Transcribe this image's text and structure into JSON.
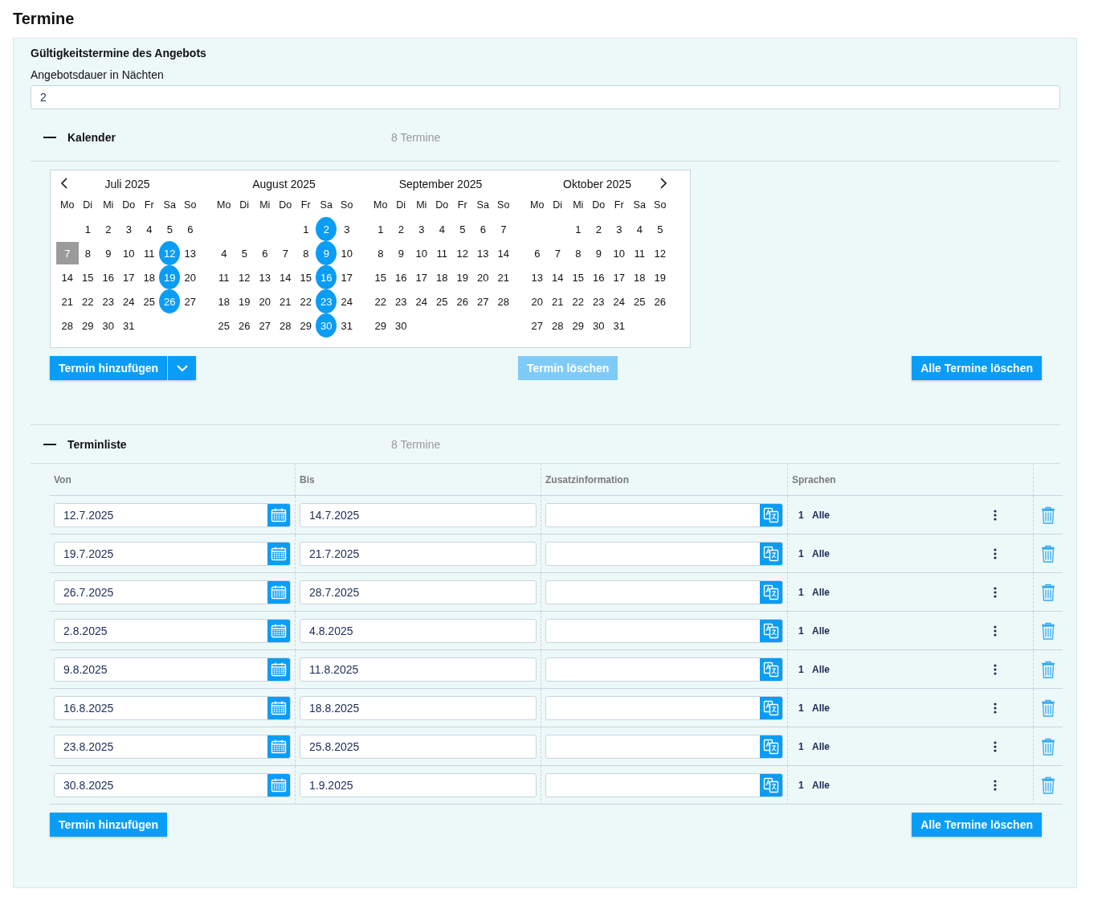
{
  "title": "Termine",
  "panel": {
    "heading": "Gültigkeitstermine des Angebots",
    "duration": {
      "label": "Angebotsdauer in Nächten",
      "value": "2"
    }
  },
  "calendar_section": {
    "title": "Kalender",
    "count": "8 Termine",
    "expanded": true,
    "months": [
      {
        "title": "Juli 2025",
        "weekdays": [
          "Mo",
          "Di",
          "Mi",
          "Do",
          "Fr",
          "Sa",
          "So"
        ],
        "weeks": [
          [
            {
              "kind": "blank"
            },
            {
              "kind": "day",
              "d": "1",
              "selected": false,
              "today": false
            },
            {
              "kind": "day",
              "d": "2",
              "selected": false,
              "today": false
            },
            {
              "kind": "day",
              "d": "3",
              "selected": false,
              "today": false
            },
            {
              "kind": "day",
              "d": "4",
              "selected": false,
              "today": false
            },
            {
              "kind": "day",
              "d": "5",
              "selected": false,
              "today": false
            },
            {
              "kind": "day",
              "d": "6",
              "selected": false,
              "today": false
            }
          ],
          [
            {
              "kind": "day",
              "d": "7",
              "selected": false,
              "today": true
            },
            {
              "kind": "day",
              "d": "8",
              "selected": false,
              "today": false
            },
            {
              "kind": "day",
              "d": "9",
              "selected": false,
              "today": false
            },
            {
              "kind": "day",
              "d": "10",
              "selected": false,
              "today": false
            },
            {
              "kind": "day",
              "d": "11",
              "selected": false,
              "today": false
            },
            {
              "kind": "day",
              "d": "12",
              "selected": true,
              "today": false
            },
            {
              "kind": "day",
              "d": "13",
              "selected": false,
              "today": false
            }
          ],
          [
            {
              "kind": "day",
              "d": "14",
              "selected": false,
              "today": false
            },
            {
              "kind": "day",
              "d": "15",
              "selected": false,
              "today": false
            },
            {
              "kind": "day",
              "d": "16",
              "selected": false,
              "today": false
            },
            {
              "kind": "day",
              "d": "17",
              "selected": false,
              "today": false
            },
            {
              "kind": "day",
              "d": "18",
              "selected": false,
              "today": false
            },
            {
              "kind": "day",
              "d": "19",
              "selected": true,
              "today": false
            },
            {
              "kind": "day",
              "d": "20",
              "selected": false,
              "today": false
            }
          ],
          [
            {
              "kind": "day",
              "d": "21",
              "selected": false,
              "today": false
            },
            {
              "kind": "day",
              "d": "22",
              "selected": false,
              "today": false
            },
            {
              "kind": "day",
              "d": "23",
              "selected": false,
              "today": false
            },
            {
              "kind": "day",
              "d": "24",
              "selected": false,
              "today": false
            },
            {
              "kind": "day",
              "d": "25",
              "selected": false,
              "today": false
            },
            {
              "kind": "day",
              "d": "26",
              "selected": true,
              "today": false
            },
            {
              "kind": "day",
              "d": "27",
              "selected": false,
              "today": false
            }
          ],
          [
            {
              "kind": "day",
              "d": "28",
              "selected": false,
              "today": false
            },
            {
              "kind": "day",
              "d": "29",
              "selected": false,
              "today": false
            },
            {
              "kind": "day",
              "d": "30",
              "selected": false,
              "today": false
            },
            {
              "kind": "day",
              "d": "31",
              "selected": false,
              "today": false
            },
            {
              "kind": "blank"
            },
            {
              "kind": "blank"
            },
            {
              "kind": "blank"
            }
          ]
        ]
      },
      {
        "title": "August 2025",
        "weekdays": [
          "Mo",
          "Di",
          "Mi",
          "Do",
          "Fr",
          "Sa",
          "So"
        ],
        "weeks": [
          [
            {
              "kind": "blank"
            },
            {
              "kind": "blank"
            },
            {
              "kind": "blank"
            },
            {
              "kind": "blank"
            },
            {
              "kind": "day",
              "d": "1",
              "selected": false,
              "today": false
            },
            {
              "kind": "day",
              "d": "2",
              "selected": true,
              "today": false
            },
            {
              "kind": "day",
              "d": "3",
              "selected": false,
              "today": false
            }
          ],
          [
            {
              "kind": "day",
              "d": "4",
              "selected": false,
              "today": false
            },
            {
              "kind": "day",
              "d": "5",
              "selected": false,
              "today": false
            },
            {
              "kind": "day",
              "d": "6",
              "selected": false,
              "today": false
            },
            {
              "kind": "day",
              "d": "7",
              "selected": false,
              "today": false
            },
            {
              "kind": "day",
              "d": "8",
              "selected": false,
              "today": false
            },
            {
              "kind": "day",
              "d": "9",
              "selected": true,
              "today": false
            },
            {
              "kind": "day",
              "d": "10",
              "selected": false,
              "today": false
            }
          ],
          [
            {
              "kind": "day",
              "d": "11",
              "selected": false,
              "today": false
            },
            {
              "kind": "day",
              "d": "12",
              "selected": false,
              "today": false
            },
            {
              "kind": "day",
              "d": "13",
              "selected": false,
              "today": false
            },
            {
              "kind": "day",
              "d": "14",
              "selected": false,
              "today": false
            },
            {
              "kind": "day",
              "d": "15",
              "selected": false,
              "today": false
            },
            {
              "kind": "day",
              "d": "16",
              "selected": true,
              "today": false
            },
            {
              "kind": "day",
              "d": "17",
              "selected": false,
              "today": false
            }
          ],
          [
            {
              "kind": "day",
              "d": "18",
              "selected": false,
              "today": false
            },
            {
              "kind": "day",
              "d": "19",
              "selected": false,
              "today": false
            },
            {
              "kind": "day",
              "d": "20",
              "selected": false,
              "today": false
            },
            {
              "kind": "day",
              "d": "21",
              "selected": false,
              "today": false
            },
            {
              "kind": "day",
              "d": "22",
              "selected": false,
              "today": false
            },
            {
              "kind": "day",
              "d": "23",
              "selected": true,
              "today": false
            },
            {
              "kind": "day",
              "d": "24",
              "selected": false,
              "today": false
            }
          ],
          [
            {
              "kind": "day",
              "d": "25",
              "selected": false,
              "today": false
            },
            {
              "kind": "day",
              "d": "26",
              "selected": false,
              "today": false
            },
            {
              "kind": "day",
              "d": "27",
              "selected": false,
              "today": false
            },
            {
              "kind": "day",
              "d": "28",
              "selected": false,
              "today": false
            },
            {
              "kind": "day",
              "d": "29",
              "selected": false,
              "today": false
            },
            {
              "kind": "day",
              "d": "30",
              "selected": true,
              "today": false
            },
            {
              "kind": "day",
              "d": "31",
              "selected": false,
              "today": false
            }
          ]
        ]
      },
      {
        "title": "September 2025",
        "weekdays": [
          "Mo",
          "Di",
          "Mi",
          "Do",
          "Fr",
          "Sa",
          "So"
        ],
        "weeks": [
          [
            {
              "kind": "day",
              "d": "1",
              "selected": false,
              "today": false
            },
            {
              "kind": "day",
              "d": "2",
              "selected": false,
              "today": false
            },
            {
              "kind": "day",
              "d": "3",
              "selected": false,
              "today": false
            },
            {
              "kind": "day",
              "d": "4",
              "selected": false,
              "today": false
            },
            {
              "kind": "day",
              "d": "5",
              "selected": false,
              "today": false
            },
            {
              "kind": "day",
              "d": "6",
              "selected": false,
              "today": false
            },
            {
              "kind": "day",
              "d": "7",
              "selected": false,
              "today": false
            }
          ],
          [
            {
              "kind": "day",
              "d": "8",
              "selected": false,
              "today": false
            },
            {
              "kind": "day",
              "d": "9",
              "selected": false,
              "today": false
            },
            {
              "kind": "day",
              "d": "10",
              "selected": false,
              "today": false
            },
            {
              "kind": "day",
              "d": "11",
              "selected": false,
              "today": false
            },
            {
              "kind": "day",
              "d": "12",
              "selected": false,
              "today": false
            },
            {
              "kind": "day",
              "d": "13",
              "selected": false,
              "today": false
            },
            {
              "kind": "day",
              "d": "14",
              "selected": false,
              "today": false
            }
          ],
          [
            {
              "kind": "day",
              "d": "15",
              "selected": false,
              "today": false
            },
            {
              "kind": "day",
              "d": "16",
              "selected": false,
              "today": false
            },
            {
              "kind": "day",
              "d": "17",
              "selected": false,
              "today": false
            },
            {
              "kind": "day",
              "d": "18",
              "selected": false,
              "today": false
            },
            {
              "kind": "day",
              "d": "19",
              "selected": false,
              "today": false
            },
            {
              "kind": "day",
              "d": "20",
              "selected": false,
              "today": false
            },
            {
              "kind": "day",
              "d": "21",
              "selected": false,
              "today": false
            }
          ],
          [
            {
              "kind": "day",
              "d": "22",
              "selected": false,
              "today": false
            },
            {
              "kind": "day",
              "d": "23",
              "selected": false,
              "today": false
            },
            {
              "kind": "day",
              "d": "24",
              "selected": false,
              "today": false
            },
            {
              "kind": "day",
              "d": "25",
              "selected": false,
              "today": false
            },
            {
              "kind": "day",
              "d": "26",
              "selected": false,
              "today": false
            },
            {
              "kind": "day",
              "d": "27",
              "selected": false,
              "today": false
            },
            {
              "kind": "day",
              "d": "28",
              "selected": false,
              "today": false
            }
          ],
          [
            {
              "kind": "day",
              "d": "29",
              "selected": false,
              "today": false
            },
            {
              "kind": "day",
              "d": "30",
              "selected": false,
              "today": false
            },
            {
              "kind": "blank"
            },
            {
              "kind": "blank"
            },
            {
              "kind": "blank"
            },
            {
              "kind": "blank"
            },
            {
              "kind": "blank"
            }
          ]
        ]
      },
      {
        "title": "Oktober 2025",
        "weekdays": [
          "Mo",
          "Di",
          "Mi",
          "Do",
          "Fr",
          "Sa",
          "So"
        ],
        "weeks": [
          [
            {
              "kind": "blank"
            },
            {
              "kind": "blank"
            },
            {
              "kind": "day",
              "d": "1",
              "selected": false,
              "today": false
            },
            {
              "kind": "day",
              "d": "2",
              "selected": false,
              "today": false
            },
            {
              "kind": "day",
              "d": "3",
              "selected": false,
              "today": false
            },
            {
              "kind": "day",
              "d": "4",
              "selected": false,
              "today": false
            },
            {
              "kind": "day",
              "d": "5",
              "selected": false,
              "today": false
            }
          ],
          [
            {
              "kind": "day",
              "d": "6",
              "selected": false,
              "today": false
            },
            {
              "kind": "day",
              "d": "7",
              "selected": false,
              "today": false
            },
            {
              "kind": "day",
              "d": "8",
              "selected": false,
              "today": false
            },
            {
              "kind": "day",
              "d": "9",
              "selected": false,
              "today": false
            },
            {
              "kind": "day",
              "d": "10",
              "selected": false,
              "today": false
            },
            {
              "kind": "day",
              "d": "11",
              "selected": false,
              "today": false
            },
            {
              "kind": "day",
              "d": "12",
              "selected": false,
              "today": false
            }
          ],
          [
            {
              "kind": "day",
              "d": "13",
              "selected": false,
              "today": false
            },
            {
              "kind": "day",
              "d": "14",
              "selected": false,
              "today": false
            },
            {
              "kind": "day",
              "d": "15",
              "selected": false,
              "today": false
            },
            {
              "kind": "day",
              "d": "16",
              "selected": false,
              "today": false
            },
            {
              "kind": "day",
              "d": "17",
              "selected": false,
              "today": false
            },
            {
              "kind": "day",
              "d": "18",
              "selected": false,
              "today": false
            },
            {
              "kind": "day",
              "d": "19",
              "selected": false,
              "today": false
            }
          ],
          [
            {
              "kind": "day",
              "d": "20",
              "selected": false,
              "today": false
            },
            {
              "kind": "day",
              "d": "21",
              "selected": false,
              "today": false
            },
            {
              "kind": "day",
              "d": "22",
              "selected": false,
              "today": false
            },
            {
              "kind": "day",
              "d": "23",
              "selected": false,
              "today": false
            },
            {
              "kind": "day",
              "d": "24",
              "selected": false,
              "today": false
            },
            {
              "kind": "day",
              "d": "25",
              "selected": false,
              "today": false
            },
            {
              "kind": "day",
              "d": "26",
              "selected": false,
              "today": false
            }
          ],
          [
            {
              "kind": "day",
              "d": "27",
              "selected": false,
              "today": false
            },
            {
              "kind": "day",
              "d": "28",
              "selected": false,
              "today": false
            },
            {
              "kind": "day",
              "d": "29",
              "selected": false,
              "today": false
            },
            {
              "kind": "day",
              "d": "30",
              "selected": false,
              "today": false
            },
            {
              "kind": "day",
              "d": "31",
              "selected": false,
              "today": false
            },
            {
              "kind": "blank"
            },
            {
              "kind": "blank"
            }
          ]
        ]
      }
    ],
    "buttons": [
      {
        "label": "Termin hinzufügen",
        "kind": "split",
        "disabled": false
      },
      {
        "label": "Termin löschen",
        "kind": "plain",
        "disabled": true
      },
      {
        "label": "Alle Termine löschen",
        "kind": "plain",
        "disabled": false
      }
    ]
  },
  "list_section": {
    "title": "Terminliste",
    "count": "8 Termine",
    "expanded": true,
    "columns": [
      "Von",
      "Bis",
      "Zusatzinformation",
      "Sprachen"
    ],
    "rows": [
      {
        "from": "12.7.2025",
        "to": "14.7.2025",
        "languages_count": "1",
        "languages": "Alle"
      },
      {
        "from": "19.7.2025",
        "to": "21.7.2025",
        "languages_count": "1",
        "languages": "Alle"
      },
      {
        "from": "26.7.2025",
        "to": "28.7.2025",
        "languages_count": "1",
        "languages": "Alle"
      },
      {
        "from": "2.8.2025",
        "to": "4.8.2025",
        "languages_count": "1",
        "languages": "Alle"
      },
      {
        "from": "9.8.2025",
        "to": "11.8.2025",
        "languages_count": "1",
        "languages": "Alle"
      },
      {
        "from": "16.8.2025",
        "to": "18.8.2025",
        "languages_count": "1",
        "languages": "Alle"
      },
      {
        "from": "23.8.2025",
        "to": "25.8.2025",
        "languages_count": "1",
        "languages": "Alle"
      },
      {
        "from": "30.8.2025",
        "to": "1.9.2025",
        "languages_count": "1",
        "languages": "Alle"
      }
    ],
    "buttons": [
      {
        "label": "Termin hinzufügen",
        "kind": "plain",
        "disabled": false
      },
      {
        "label": "Alle Termine löschen",
        "kind": "plain",
        "disabled": false
      }
    ]
  }
}
